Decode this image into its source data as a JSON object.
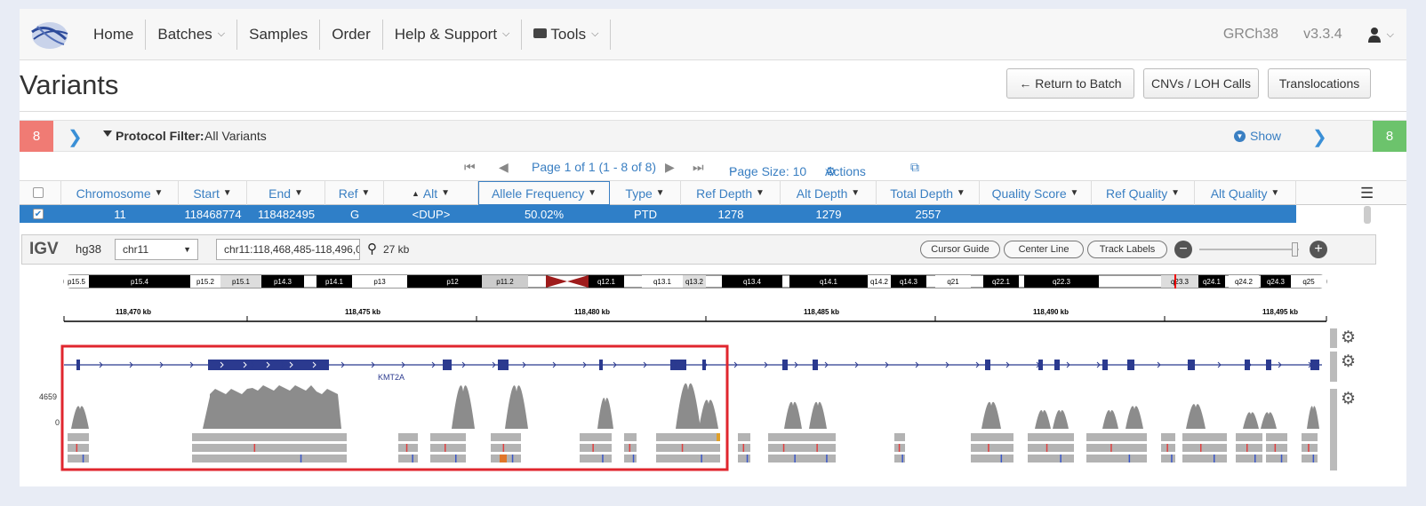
{
  "nav": {
    "items": [
      {
        "label": "Home",
        "caret": false,
        "icon": ""
      },
      {
        "label": "Batches",
        "caret": true,
        "icon": ""
      },
      {
        "label": "Samples",
        "caret": false,
        "icon": ""
      },
      {
        "label": "Order",
        "caret": false,
        "icon": ""
      },
      {
        "label": "Help & Support",
        "caret": true,
        "icon": ""
      },
      {
        "label": "Tools",
        "caret": true,
        "icon": "toolbox-icon"
      }
    ],
    "genome": "GRCh38",
    "version": "v3.3.4",
    "user_icon": "user-icon"
  },
  "page": {
    "title": "Variants",
    "buttons": {
      "return": "← Return to Batch",
      "cnvs": "CNVs / LOH Calls",
      "translocations": "Translocations"
    }
  },
  "filter": {
    "left_count": "8",
    "right_count": "8",
    "label": "Protocol Filter:",
    "value": "All Variants",
    "show": "Show"
  },
  "pager": {
    "page_info": "Page 1 of 1 (1 - 8 of 8)",
    "page_size": "Page Size: 10",
    "actions": "Actions"
  },
  "table": {
    "columns": [
      "Chromosome",
      "Start",
      "End",
      "Ref",
      "Alt",
      "Allele Frequency",
      "Type",
      "Ref Depth",
      "Alt Depth",
      "Total Depth",
      "Quality Score",
      "Ref Quality",
      "Alt Quality"
    ],
    "rows": [
      [
        "11",
        "118468774",
        "118482495",
        "G",
        "<DUP>",
        "50.02%",
        "PTD",
        "1278",
        "1279",
        "2557",
        "",
        "",
        ""
      ]
    ]
  },
  "igv": {
    "logo": "IGV",
    "genome": "hg38",
    "chromosome": "chr11",
    "locus": "chr11:118,468,485-118,496,088",
    "width_label": "27 kb",
    "buttons": [
      "Cursor Guide",
      "Center Line",
      "Track Labels"
    ],
    "bands": [
      "p15.5",
      "p15.4",
      "p15.2",
      "p15.1",
      "p14.3",
      "p14.1",
      "p13",
      "p12",
      "p11.2",
      "q12.1",
      "q13.1",
      "q13.2",
      "q13.4",
      "q14.1",
      "q14.2",
      "q14.3",
      "q21",
      "q22.1",
      "q22.3",
      "q23.3",
      "q24.1",
      "q24.2",
      "q24.3",
      "q25"
    ],
    "ruler": [
      "118,470 kb",
      "118,475 kb",
      "118,480 kb",
      "118,485 kb",
      "118,490 kb",
      "118,495 kb"
    ],
    "gene": "KMT2A",
    "coverage_max": "4659",
    "coverage_min": "0"
  }
}
